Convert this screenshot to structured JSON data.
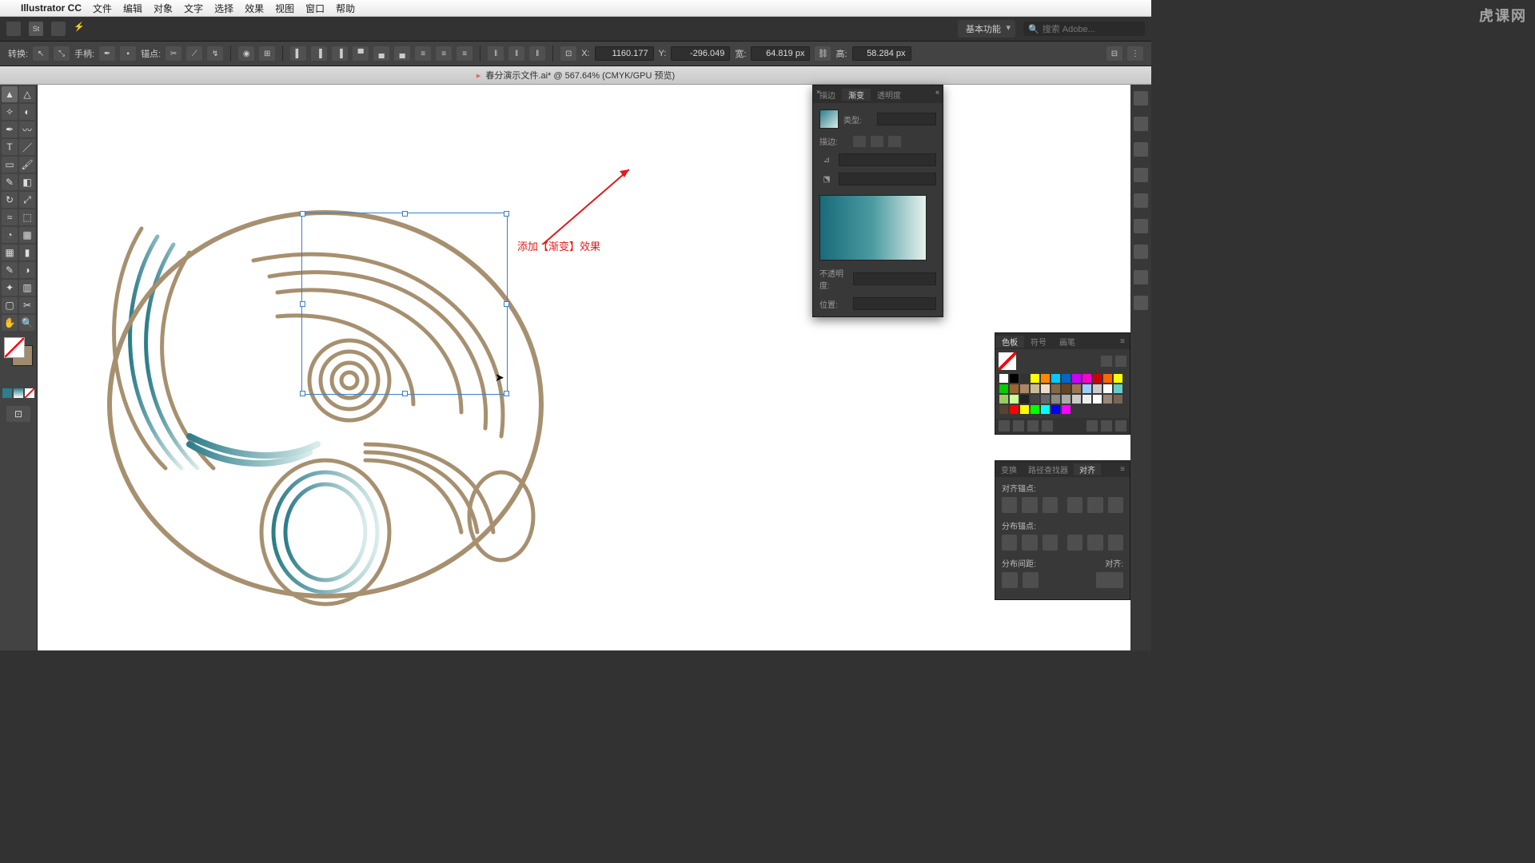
{
  "menubar": {
    "app": "Illustrator CC",
    "items": [
      "文件",
      "编辑",
      "对象",
      "文字",
      "选择",
      "效果",
      "视图",
      "窗口",
      "帮助"
    ]
  },
  "topbar": {
    "workspace": "基本功能",
    "search_ph": "搜索 Adobe..."
  },
  "controlbar": {
    "transform": "转换:",
    "hand": "手柄:",
    "anchor": "锚点:",
    "x_lbl": "X:",
    "x": "1160.177",
    "y_lbl": "Y:",
    "y": "-296.049",
    "w_lbl": "宽:",
    "w": "64.819 px",
    "h_lbl": "高:",
    "h": "58.284 px"
  },
  "doc_tab": "春分演示文件.ai* @ 567.64% (CMYK/GPU 预览)",
  "gradient_panel": {
    "t1": "描边",
    "t2": "渐变",
    "t3": "透明度",
    "type": "类型:",
    "stroke": "描边:",
    "opacity": "不透明度:",
    "loc": "位置:"
  },
  "swatch_panel": {
    "t1": "色板",
    "t2": "符号",
    "t3": "画笔"
  },
  "align_panel": {
    "t1": "变换",
    "t2": "路径查找器",
    "t3": "对齐",
    "s1": "对齐锚点:",
    "s2": "分布锚点:",
    "s3": "分布间距:",
    "s4": "对齐:"
  },
  "annotation": "添加【渐变】效果",
  "watermark": "虎课网"
}
